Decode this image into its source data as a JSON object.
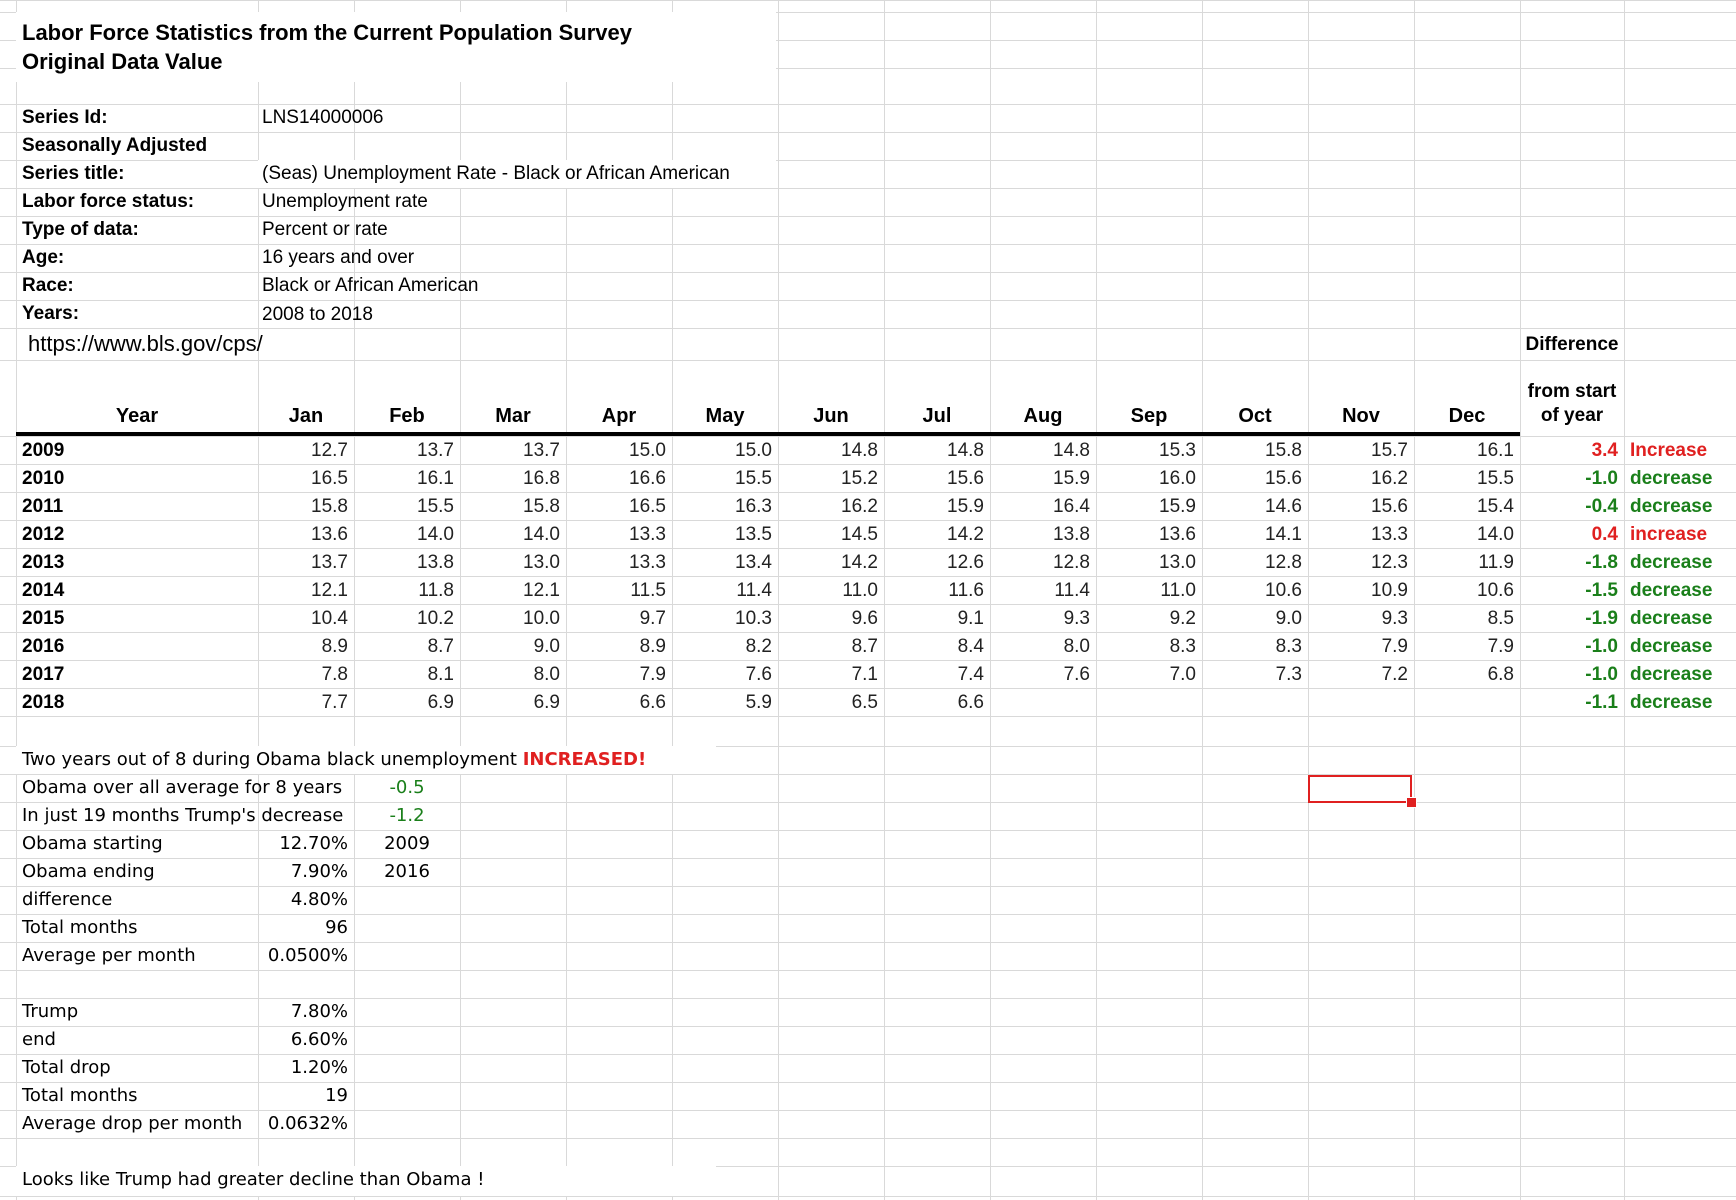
{
  "title_line1": "Labor Force Statistics from the Current Population Survey",
  "title_line2": "Original Data Value",
  "meta": [
    {
      "label": "Series Id:",
      "value": "LNS14000006"
    },
    {
      "label": "Seasonally Adjusted",
      "value": ""
    },
    {
      "label": "Series title:",
      "value": "(Seas) Unemployment Rate - Black or African American"
    },
    {
      "label": "Labor force status:",
      "value": "Unemployment rate"
    },
    {
      "label": "Type of data:",
      "value": "Percent or rate"
    },
    {
      "label": "Age:",
      "value": "16 years and over"
    },
    {
      "label": "Race:",
      "value": "Black or African American"
    },
    {
      "label": "Years:",
      "value": "2008 to 2018"
    }
  ],
  "url": "https://www.bls.gov/cps/",
  "difference_header_line1": "Difference",
  "difference_header_line2": "from start",
  "difference_header_line3": "of year",
  "year_header": "Year",
  "months": [
    "Jan",
    "Feb",
    "Mar",
    "Apr",
    "May",
    "Jun",
    "Jul",
    "Aug",
    "Sep",
    "Oct",
    "Nov",
    "Dec"
  ],
  "rows": [
    {
      "year": "2009",
      "values": [
        "12.7",
        "13.7",
        "13.7",
        "15.0",
        "15.0",
        "14.8",
        "14.8",
        "14.8",
        "15.3",
        "15.8",
        "15.7",
        "16.1"
      ],
      "diff": "3.4",
      "label": "Increase",
      "color": "#e02020"
    },
    {
      "year": "2010",
      "values": [
        "16.5",
        "16.1",
        "16.8",
        "16.6",
        "15.5",
        "15.2",
        "15.6",
        "15.9",
        "16.0",
        "15.6",
        "16.2",
        "15.5"
      ],
      "diff": "-1.0",
      "label": "decrease",
      "color": "#1a7f1a"
    },
    {
      "year": "2011",
      "values": [
        "15.8",
        "15.5",
        "15.8",
        "16.5",
        "16.3",
        "16.2",
        "15.9",
        "16.4",
        "15.9",
        "14.6",
        "15.6",
        "15.4"
      ],
      "diff": "-0.4",
      "label": "decrease",
      "color": "#1a7f1a"
    },
    {
      "year": "2012",
      "values": [
        "13.6",
        "14.0",
        "14.0",
        "13.3",
        "13.5",
        "14.5",
        "14.2",
        "13.8",
        "13.6",
        "14.1",
        "13.3",
        "14.0"
      ],
      "diff": "0.4",
      "label": "increase",
      "color": "#e02020"
    },
    {
      "year": "2013",
      "values": [
        "13.7",
        "13.8",
        "13.0",
        "13.3",
        "13.4",
        "14.2",
        "12.6",
        "12.8",
        "13.0",
        "12.8",
        "12.3",
        "11.9"
      ],
      "diff": "-1.8",
      "label": "decrease",
      "color": "#1a7f1a"
    },
    {
      "year": "2014",
      "values": [
        "12.1",
        "11.8",
        "12.1",
        "11.5",
        "11.4",
        "11.0",
        "11.6",
        "11.4",
        "11.0",
        "10.6",
        "10.9",
        "10.6"
      ],
      "diff": "-1.5",
      "label": "decrease",
      "color": "#1a7f1a"
    },
    {
      "year": "2015",
      "values": [
        "10.4",
        "10.2",
        "10.0",
        "9.7",
        "10.3",
        "9.6",
        "9.1",
        "9.3",
        "9.2",
        "9.0",
        "9.3",
        "8.5"
      ],
      "diff": "-1.9",
      "label": "decrease",
      "color": "#1a7f1a"
    },
    {
      "year": "2016",
      "values": [
        "8.9",
        "8.7",
        "9.0",
        "8.9",
        "8.2",
        "8.7",
        "8.4",
        "8.0",
        "8.3",
        "8.3",
        "7.9",
        "7.9"
      ],
      "diff": "-1.0",
      "label": "decrease",
      "color": "#1a7f1a"
    },
    {
      "year": "2017",
      "values": [
        "7.8",
        "8.1",
        "8.0",
        "7.9",
        "7.6",
        "7.1",
        "7.4",
        "7.6",
        "7.0",
        "7.3",
        "7.2",
        "6.8"
      ],
      "diff": "-1.0",
      "label": "decrease",
      "color": "#1a7f1a"
    },
    {
      "year": "2018",
      "values": [
        "7.7",
        "6.9",
        "6.9",
        "6.6",
        "5.9",
        "6.5",
        "6.6",
        "",
        "",
        "",
        "",
        ""
      ],
      "diff": "-1.1",
      "label": "decrease",
      "color": "#1a7f1a"
    }
  ],
  "notes": {
    "line1_prefix": "Two years out of 8 during Obama black unemployment ",
    "line1_emph": "INCREASED!",
    "obama_avg_label": "Obama  over all average for 8 years",
    "obama_avg_value": "-0.5",
    "trump_decrease_label": "In just 19 months Trump's decrease",
    "trump_decrease_value": "-1.2",
    "obama_starting_label": "Obama starting",
    "obama_starting_value": "12.70%",
    "obama_starting_year": "2009",
    "obama_ending_label": "Obama ending",
    "obama_ending_value": "7.90%",
    "obama_ending_year": "2016",
    "difference_label": "difference",
    "difference_value": "4.80%",
    "obama_total_months_label": "Total months",
    "obama_total_months_value": "96",
    "avg_per_month_label": "Average per month",
    "avg_per_month_value": "0.0500%",
    "trump_label": "Trump",
    "trump_value": "7.80%",
    "end_label": "end",
    "end_value": "6.60%",
    "total_drop_label": "Total drop",
    "total_drop_value": "1.20%",
    "trump_total_months_label": "Total months",
    "trump_total_months_value": "19",
    "avg_drop_label": "Average drop per month",
    "avg_drop_value": "0.0632%",
    "conclusion": "Looks like Trump had greater decline than Obama !"
  },
  "colors": {
    "increase": "#e02020",
    "decrease": "#1a7f1a",
    "gridline": "#d9d9d9",
    "selection": "#e02020"
  }
}
